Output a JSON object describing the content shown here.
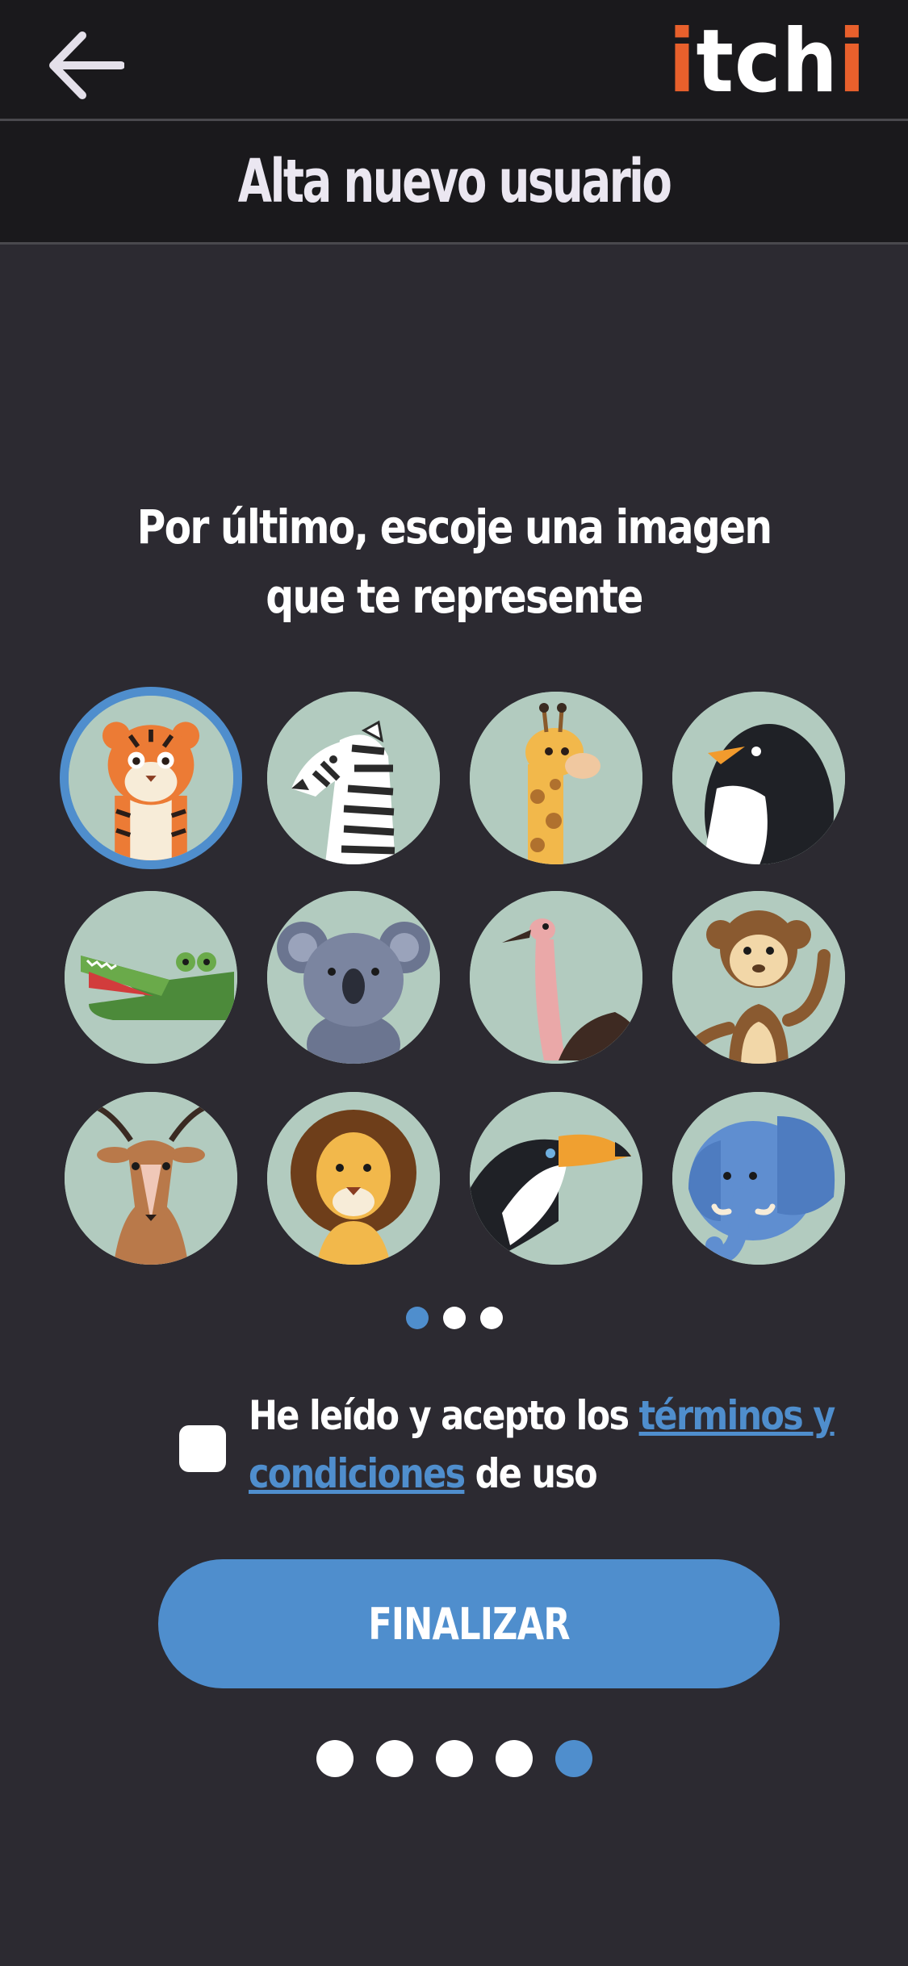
{
  "header": {
    "back_icon": "arrow-left-icon",
    "logo_parts": [
      "i",
      "tch",
      "i"
    ],
    "logo_accent_color": "#e8602c"
  },
  "title": "Alta nuevo usuario",
  "prompt_line1": "Por último, escoje una imagen",
  "prompt_line2": "que te represente",
  "avatars": [
    {
      "name": "tiger",
      "selected": true
    },
    {
      "name": "zebra",
      "selected": false
    },
    {
      "name": "giraffe",
      "selected": false
    },
    {
      "name": "penguin",
      "selected": false
    },
    {
      "name": "crocodile",
      "selected": false
    },
    {
      "name": "koala",
      "selected": false
    },
    {
      "name": "ostrich",
      "selected": false
    },
    {
      "name": "monkey",
      "selected": false
    },
    {
      "name": "antelope",
      "selected": false
    },
    {
      "name": "lion",
      "selected": false
    },
    {
      "name": "toucan",
      "selected": false
    },
    {
      "name": "elephant",
      "selected": false
    }
  ],
  "avatar_pager": {
    "count": 3,
    "active": 1
  },
  "terms": {
    "before": "He leído y acepto los ",
    "link_line1": "términos y",
    "link_line2": "condiciones",
    "after": " de uso",
    "checked": false
  },
  "finish_button": "FINALIZAR",
  "step_pager": {
    "count": 5,
    "active": 5
  },
  "colors": {
    "background": "#2c2a31",
    "bar": "#1a191c",
    "accent": "#4f8ecd",
    "avatar_bg": "#b2cbbf"
  }
}
